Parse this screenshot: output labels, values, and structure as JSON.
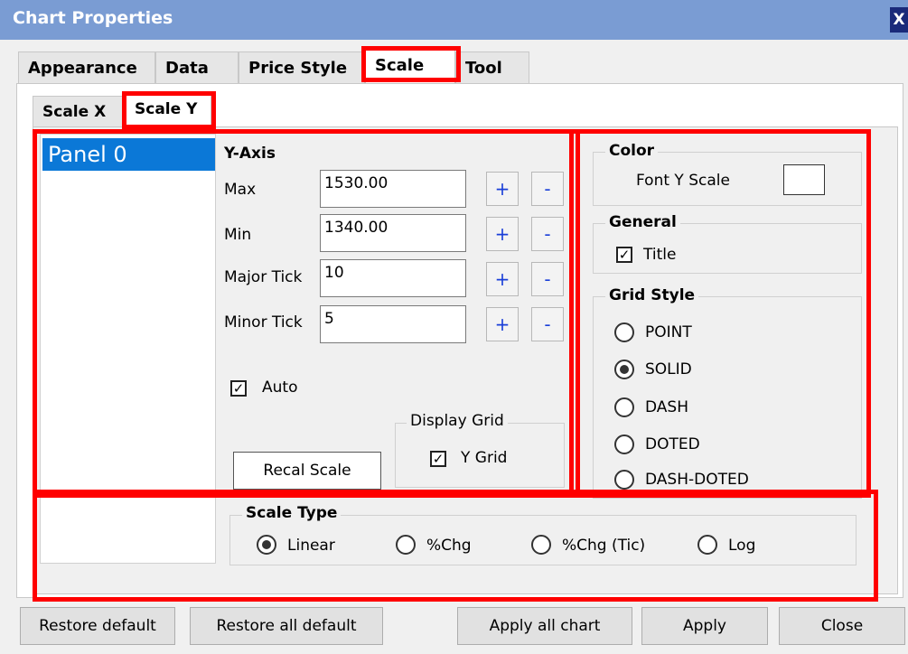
{
  "window": {
    "title": "Chart Properties",
    "close_glyph": "X"
  },
  "tabs": [
    "Appearance",
    "Data",
    "Price Style",
    "Scale",
    "Tool"
  ],
  "scale_tabs": [
    "Scale X",
    "Scale Y"
  ],
  "panel_list": [
    "Panel 0"
  ],
  "y_axis": {
    "heading": "Y-Axis",
    "max_label": "Max",
    "max_value": "1530.00",
    "min_label": "Min",
    "min_value": "1340.00",
    "major_tick_label": "Major Tick",
    "major_tick_value": "10",
    "minor_tick_label": "Minor Tick",
    "minor_tick_value": "5",
    "plus": "+",
    "minus": "-",
    "auto_label": "Auto",
    "auto_checked": true,
    "recal_button": "Recal Scale"
  },
  "display_grid": {
    "title": "Display Grid",
    "y_grid_label": "Y Grid",
    "y_grid_checked": true
  },
  "color": {
    "title": "Color",
    "font_y_scale_label": "Font Y Scale"
  },
  "general": {
    "title": "General",
    "title_label": "Title",
    "title_checked": true
  },
  "grid_style": {
    "title": "Grid Style",
    "options": [
      "POINT",
      "SOLID",
      "DASH",
      "DOTED",
      "DASH-DOTED"
    ],
    "selected": "SOLID"
  },
  "scale_type": {
    "title": "Scale Type",
    "options": [
      "Linear",
      "%Chg",
      "%Chg (Tic)",
      "Log"
    ],
    "selected": "Linear"
  },
  "footer": {
    "restore_default": "Restore default",
    "restore_all_default": "Restore all default",
    "apply_all_chart": "Apply all chart",
    "apply": "Apply",
    "close": "Close"
  },
  "colors": {
    "titlebar": "#7a9cd3",
    "selection": "#0b78d7",
    "highlight": "#ff0000",
    "plus_minus": "#1a3fd8"
  }
}
